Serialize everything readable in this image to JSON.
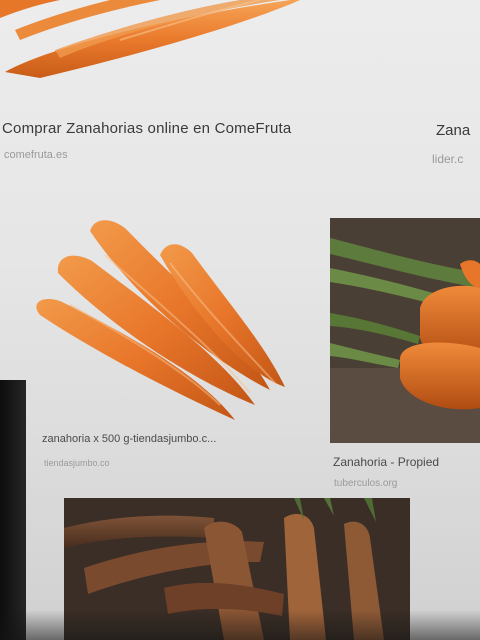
{
  "results": [
    {
      "caption": "Comprar Zanahorias online en ComeFruta",
      "source": "comefruta.es",
      "image": "carrot-bunch-image"
    },
    {
      "caption": "Zana",
      "source": "lider.c",
      "image": "carrot-image"
    },
    {
      "caption": "zanahoria x 500 g-tiendasjumbo.c...",
      "source": "tiendasjumbo.co",
      "image": "carrots-with-shadow-image"
    },
    {
      "caption": "Zanahoria - Propied",
      "source": "tuberculos.org",
      "image": "carrots-with-greens-image"
    },
    {
      "caption": "",
      "source": "",
      "image": "dark-carrots-photo"
    }
  ],
  "colors": {
    "carrot": "#e9742a",
    "carrot_light": "#f4a052",
    "carrot_dark": "#b84e14",
    "greens": "#5b7a3a",
    "page_bg": "#e8e8e8"
  }
}
